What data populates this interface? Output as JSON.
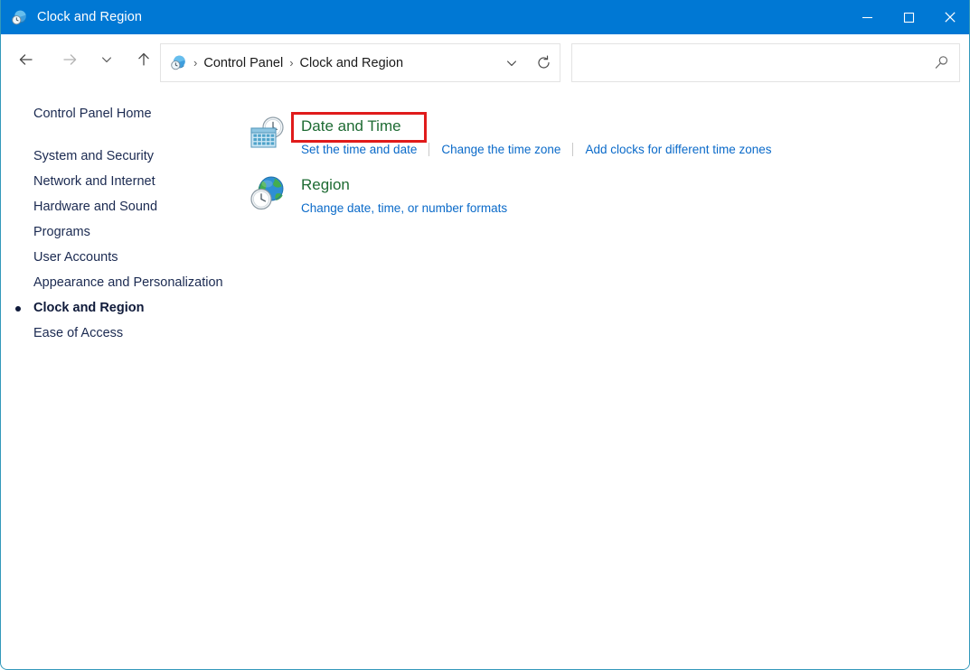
{
  "window": {
    "title": "Clock and Region",
    "title_icon": "clock-globe-icon",
    "accent_color": "#0078d4",
    "controls": {
      "minimize": "Minimize",
      "maximize": "Maximize",
      "close": "Close"
    }
  },
  "toolbar": {
    "back": "Back",
    "forward": "Forward",
    "recent": "Recent locations",
    "up": "Up one level"
  },
  "address": {
    "icon": "clock-globe-icon",
    "separator": "›",
    "crumbs": [
      "Control Panel",
      "Clock and Region"
    ],
    "dropdown": "Previous locations",
    "refresh": "Refresh"
  },
  "search": {
    "value": "",
    "placeholder": "",
    "icon": "search-icon"
  },
  "sidebar": {
    "home": "Control Panel Home",
    "items": [
      {
        "label": "System and Security",
        "selected": false
      },
      {
        "label": "Network and Internet",
        "selected": false
      },
      {
        "label": "Hardware and Sound",
        "selected": false
      },
      {
        "label": "Programs",
        "selected": false
      },
      {
        "label": "User Accounts",
        "selected": false
      },
      {
        "label": "Appearance and Personalization",
        "selected": false
      },
      {
        "label": "Clock and Region",
        "selected": true
      },
      {
        "label": "Ease of Access",
        "selected": false
      }
    ]
  },
  "content": {
    "categories": [
      {
        "icon": "calendar-clock-icon",
        "title": "Date and Time",
        "title_color": "#1e6b33",
        "highlighted": true,
        "links": [
          "Set the time and date",
          "Change the time zone",
          "Add clocks for different time zones"
        ]
      },
      {
        "icon": "globe-clock-icon",
        "title": "Region",
        "title_color": "#1e6b33",
        "highlighted": false,
        "links": [
          "Change date, time, or number formats"
        ]
      }
    ]
  },
  "annotation": {
    "name": "date-and-time-highlight",
    "color": "#e01b1b",
    "target": "Date and Time"
  }
}
